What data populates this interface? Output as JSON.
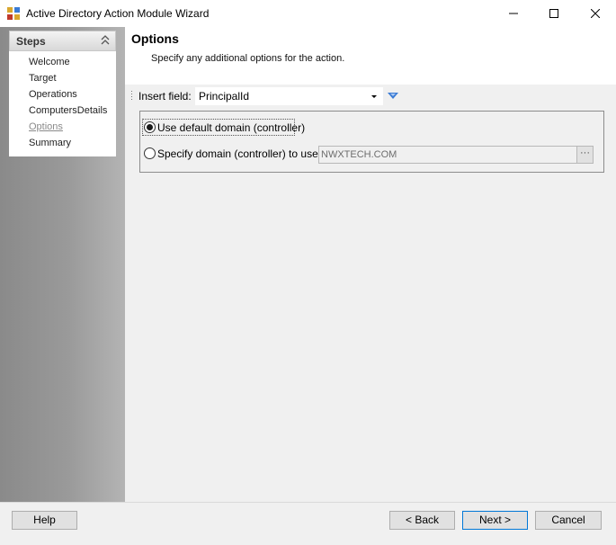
{
  "window": {
    "title": "Active Directory Action Module Wizard",
    "icon": "app-icon",
    "controls": [
      "minimize-icon",
      "maximize-icon",
      "close-icon"
    ]
  },
  "steps": {
    "title": "Steps",
    "items": [
      {
        "label": "Welcome",
        "active": false
      },
      {
        "label": "Target",
        "active": false
      },
      {
        "label": "Operations",
        "active": false
      },
      {
        "label": "ComputersDetails",
        "active": false
      },
      {
        "label": "Options",
        "active": true
      },
      {
        "label": "Summary",
        "active": false
      }
    ]
  },
  "page": {
    "title": "Options",
    "subtitle": "Specify any additional options for the action."
  },
  "insert_field": {
    "label": "Insert field:",
    "value": "PrincipalId"
  },
  "options": {
    "default_domain_label": "Use default domain (controller)",
    "default_domain_selected": true,
    "specify_domain_label": "Specify domain (controller) to use:",
    "specify_domain_selected": false,
    "domain_value": "NWXTECH.COM",
    "browse_label": "···"
  },
  "footer": {
    "help": "Help",
    "back": "< Back",
    "next": "Next >",
    "cancel": "Cancel"
  },
  "colors": {
    "accent": "#0078d7",
    "sidebar": "#9a9a9a",
    "disabled_text": "#6d6d6d"
  }
}
